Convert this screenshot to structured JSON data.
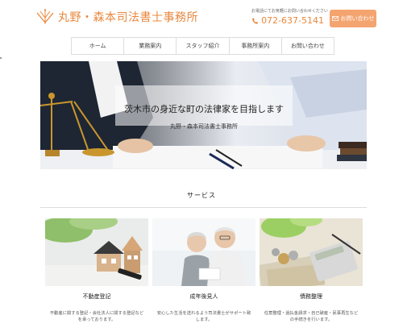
{
  "header": {
    "logo_text": "丸野・森本司法書士事務所",
    "contact_note": "お電話にてお気軽にお問い合わせください",
    "phone": "072-637-5141",
    "inquiry_label": "お問い合わせ"
  },
  "nav": {
    "items": [
      {
        "label": "ホーム"
      },
      {
        "label": "業務案内"
      },
      {
        "label": "スタッフ紹介"
      },
      {
        "label": "事務所案内"
      },
      {
        "label": "お問い合わせ"
      }
    ]
  },
  "hero": {
    "title": "茨木市の身近な町の法律家を目指します",
    "subtitle": "丸野・森本司法書士事務所"
  },
  "services": {
    "title": "サービス",
    "cards": [
      {
        "title": "不動産登記",
        "desc": "不動産に関する登記・会社法人に関する登記などを承っております。"
      },
      {
        "title": "成年後見人",
        "desc": "安心した生活を送れるよう司法書士がサポート致します。"
      },
      {
        "title": "債務整理",
        "desc": "任意整理・過払金請求・自己破産・民事再生などの手続きを行います。"
      }
    ]
  },
  "colors": {
    "accent": "#e8883f",
    "button": "#f4a46f"
  },
  "icons": [
    "scales-logo-icon",
    "phone-icon",
    "mail-icon"
  ]
}
